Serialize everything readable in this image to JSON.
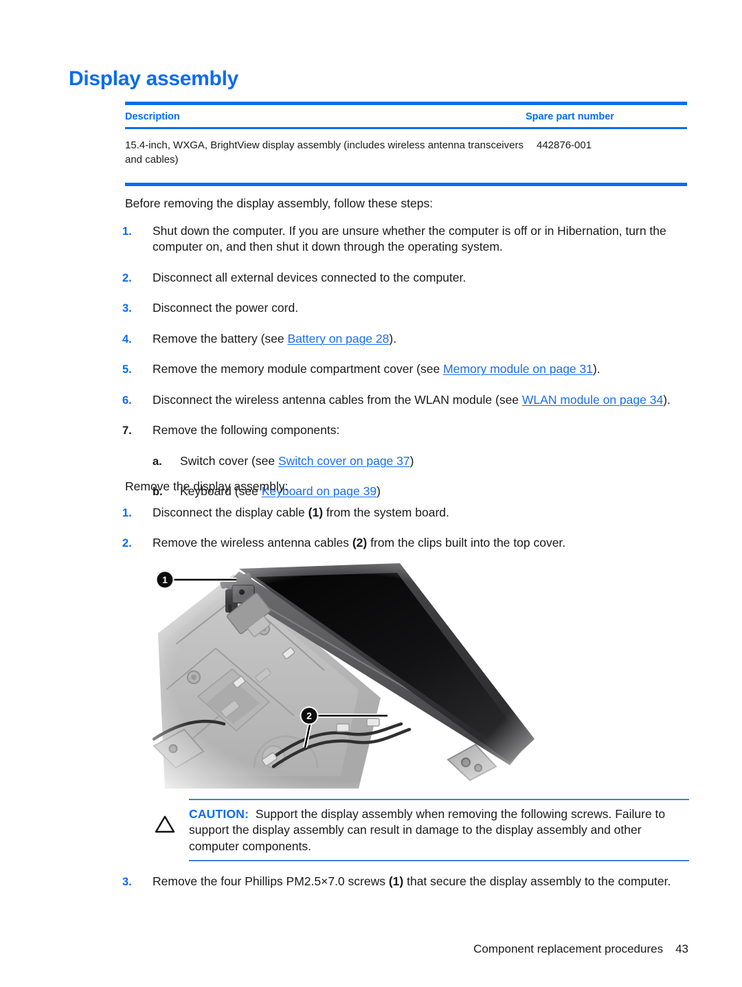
{
  "page": {
    "title": "Display assembly",
    "footer_text": "Component replacement procedures",
    "footer_page_number": "43"
  },
  "colors": {
    "accent_blue": "#0b6cf0",
    "link_blue": "#1b6ef0",
    "body_text": "#1a1a1a"
  },
  "parts_table": {
    "headers": {
      "description": "Description",
      "spare_part_number": "Spare part number"
    },
    "rows": [
      {
        "description": "15.4-inch, WXGA, BrightView display assembly (includes wireless antenna transceivers and cables)",
        "spare_part_number": "442876-001"
      }
    ]
  },
  "intro": {
    "lead": "Before removing the display assembly, follow these steps:"
  },
  "prep_steps": [
    {
      "marker": "1.",
      "marker_color": "blue",
      "text": "Shut down the computer. If you are unsure whether the computer is off or in Hibernation, turn the computer on, and then shut it down through the operating system."
    },
    {
      "marker": "2.",
      "marker_color": "blue",
      "text": "Disconnect all external devices connected to the computer."
    },
    {
      "marker": "3.",
      "marker_color": "blue",
      "text": "Disconnect the power cord."
    },
    {
      "marker": "4.",
      "marker_color": "blue",
      "prefix": "Remove the battery (see ",
      "link": "Battery on page 28",
      "suffix": ")."
    },
    {
      "marker": "5.",
      "marker_color": "blue",
      "prefix": "Remove the memory module compartment cover (see ",
      "link": "Memory module on page 31",
      "suffix": ")."
    },
    {
      "marker": "6.",
      "marker_color": "blue",
      "prefix": "Disconnect the wireless antenna cables from the WLAN module (see ",
      "link": "WLAN module on page 34",
      "suffix": ")."
    },
    {
      "marker": "7.",
      "marker_color": "black",
      "text": "Remove the following components:"
    }
  ],
  "prep_substeps": [
    {
      "marker": "a.",
      "prefix": "Switch cover (see ",
      "link": "Switch cover on page 37",
      "suffix": ")"
    },
    {
      "marker": "b.",
      "prefix": "Keyboard (see ",
      "link": "Keyboard on page 39",
      "suffix": ")"
    }
  ],
  "removal": {
    "lead": "Remove the display assembly:",
    "steps": [
      {
        "marker": "1.",
        "prefix": "Disconnect the display cable ",
        "callout": "(1)",
        "suffix": " from the system board."
      },
      {
        "marker": "2.",
        "prefix": "Remove the wireless antenna cables ",
        "callout": "(2)",
        "suffix": " from the clips built into the top cover."
      }
    ],
    "final_step": {
      "marker": "3.",
      "prefix": "Remove the four Phillips PM2.5×7.0 screws ",
      "callout": "(1)",
      "suffix": " that secure the display assembly to the computer."
    }
  },
  "figure": {
    "alt": "Laptop top cover with display assembly tilted back, display cable and wireless antenna cables visible",
    "callouts": [
      {
        "label": "1",
        "describes": "display cable connector on system board"
      },
      {
        "label": "2",
        "describes": "wireless antenna cables routed through clips in top cover"
      }
    ]
  },
  "caution": {
    "icon": "caution-triangle-icon",
    "label": "CAUTION:",
    "text": "Support the display assembly when removing the following screws. Failure to support the display assembly can result in damage to the display assembly and other computer components."
  }
}
